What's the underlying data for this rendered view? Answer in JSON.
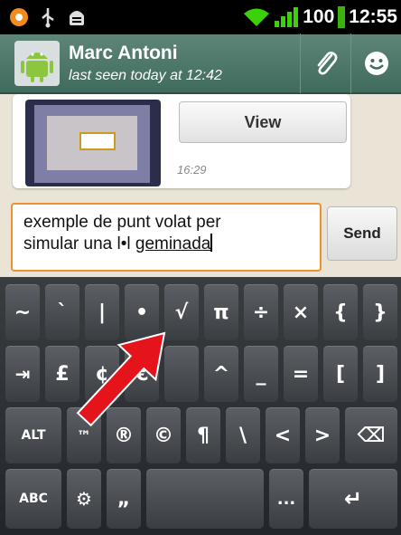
{
  "status_bar": {
    "battery_level": "100",
    "time": "12:55",
    "icons": [
      "app-notification-icon",
      "usb-icon",
      "android-debug-icon",
      "wifi-icon",
      "signal-icon"
    ]
  },
  "header": {
    "contact_name": "Marc Antoni",
    "last_seen": "last seen today at 12:42",
    "icons": [
      "avatar-icon",
      "attach-icon",
      "emoji-icon"
    ]
  },
  "chat": {
    "message": {
      "view_label": "View",
      "time": "16:29"
    },
    "input": {
      "text_line1": "exemple de punt volat per",
      "text_line2_start": "simular una l•l ",
      "text_line2_underlined": "geminada"
    },
    "send_label": "Send"
  },
  "keyboard": {
    "row1": [
      "~",
      "`",
      "|",
      "•",
      "√",
      "π",
      "÷",
      "×",
      "{",
      "}"
    ],
    "row2": [
      "⇥",
      "£",
      "¢",
      "€",
      "",
      "^",
      "_",
      "=",
      "[",
      "]"
    ],
    "row3": [
      "ALT",
      "™",
      "®",
      "©",
      "¶",
      "\\",
      "<",
      ">",
      "⌫"
    ],
    "row4": [
      "ABC",
      "⚙",
      "„",
      " ",
      "...",
      "↵"
    ]
  },
  "annotation": {
    "color": "#e5141b",
    "type": "arrow"
  }
}
